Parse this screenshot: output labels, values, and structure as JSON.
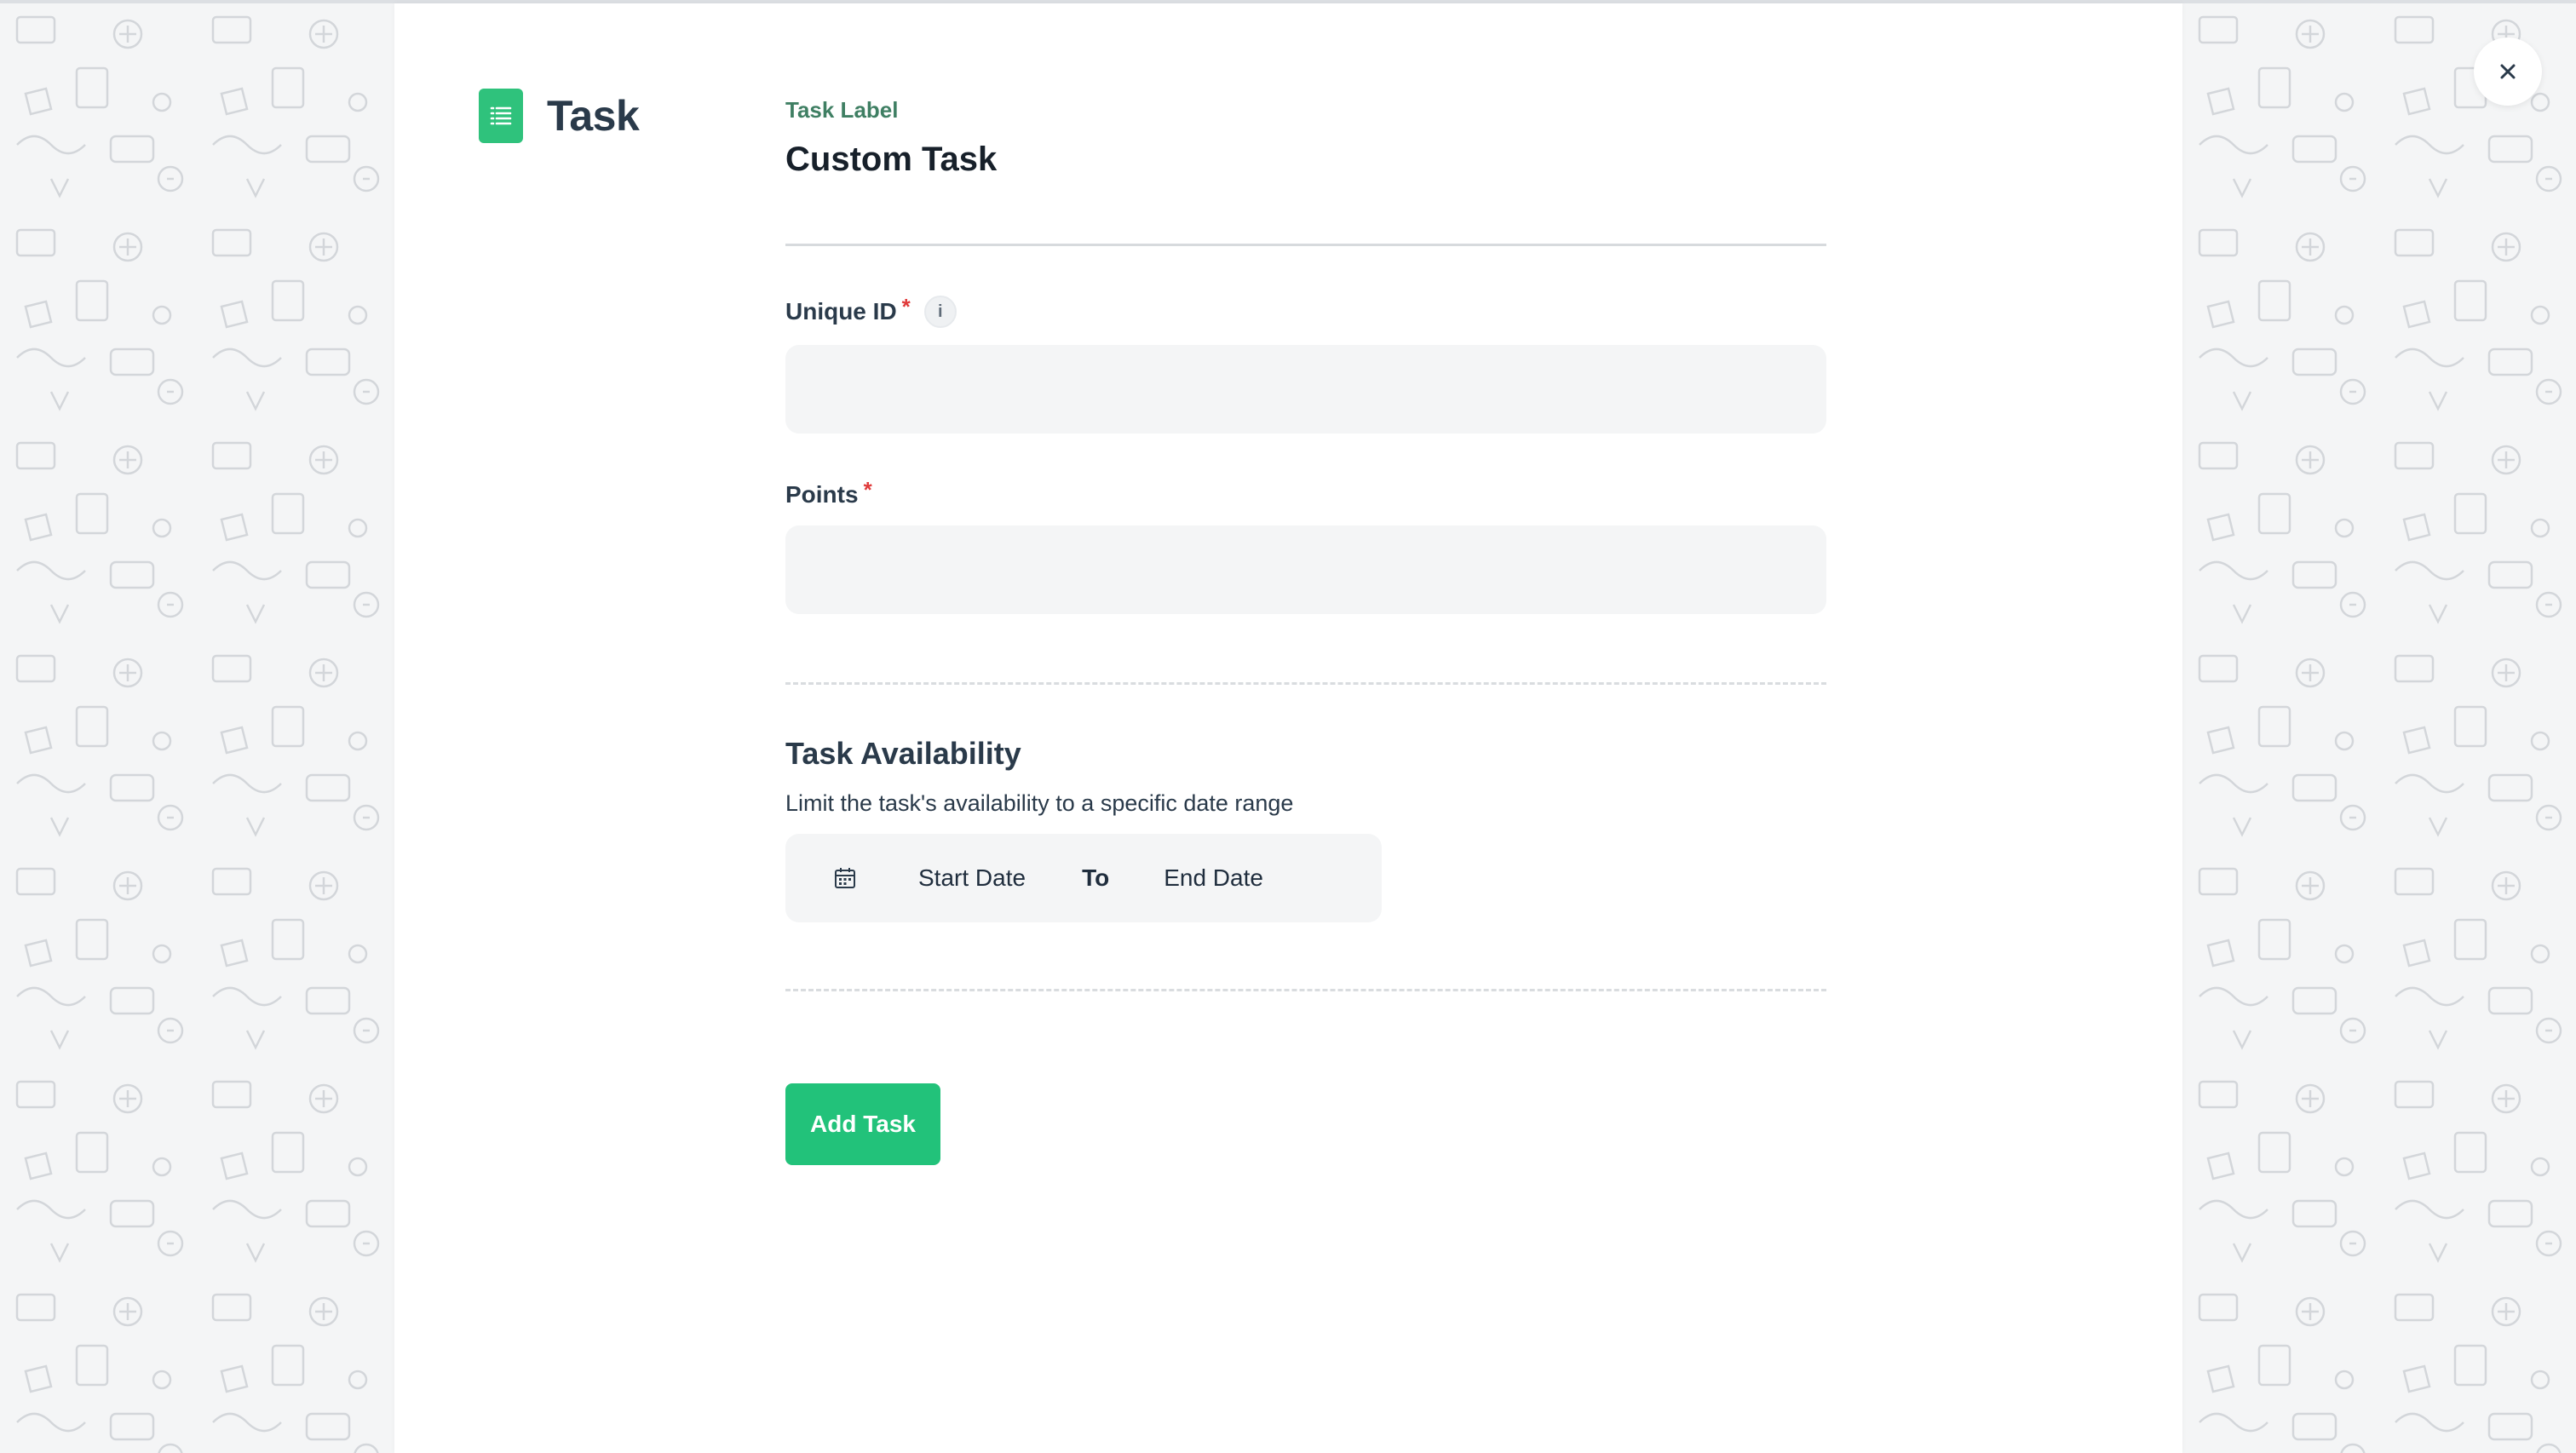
{
  "header": {
    "title": "Task",
    "icon": "list-document-icon",
    "icon_color": "#2fc27c"
  },
  "form": {
    "task_label_caption": "Task Label",
    "task_label_value": "Custom Task",
    "unique_id": {
      "label": "Unique ID",
      "required_mark": "*",
      "info_glyph": "i",
      "value": "",
      "placeholder": ""
    },
    "points": {
      "label": "Points",
      "required_mark": "*",
      "value": "",
      "placeholder": ""
    }
  },
  "availability": {
    "title": "Task Availability",
    "description": "Limit the task's availability to a specific date range",
    "start_date": "Start Date",
    "separator": "To",
    "end_date": "End Date",
    "icon": "calendar-icon"
  },
  "actions": {
    "add_label": "Add Task",
    "add_color": "#22c27a",
    "close_glyph": "×"
  },
  "colors": {
    "accent": "#22c27a",
    "required": "#e03a3a",
    "label_green": "#3f7f63"
  }
}
